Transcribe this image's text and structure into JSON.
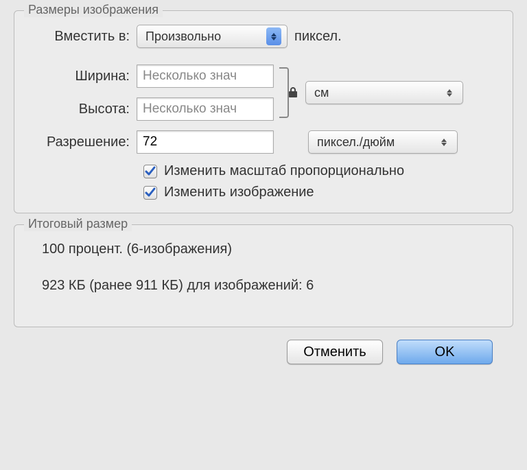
{
  "sections": {
    "dimensions_legend": "Размеры изображения",
    "result_legend": "Итоговый размер"
  },
  "fit": {
    "label": "Вместить в:",
    "value": "Произвольно",
    "unit": "пиксел."
  },
  "width": {
    "label": "Ширина:",
    "placeholder": "Несколько знач"
  },
  "height": {
    "label": "Высота:",
    "placeholder": "Несколько знач"
  },
  "dim_unit": {
    "value": "см"
  },
  "resolution": {
    "label": "Разрешение:",
    "value": "72",
    "unit": "пиксел./дюйм"
  },
  "checkboxes": {
    "proportional": "Изменить масштаб пропорционально",
    "resize_image": "Изменить изображение"
  },
  "result": {
    "line1": "100 процент. (6-изображения)",
    "line2": "923 КБ (ранее 911 КБ) для изображений: 6"
  },
  "buttons": {
    "cancel": "Отменить",
    "ok": "OK"
  }
}
